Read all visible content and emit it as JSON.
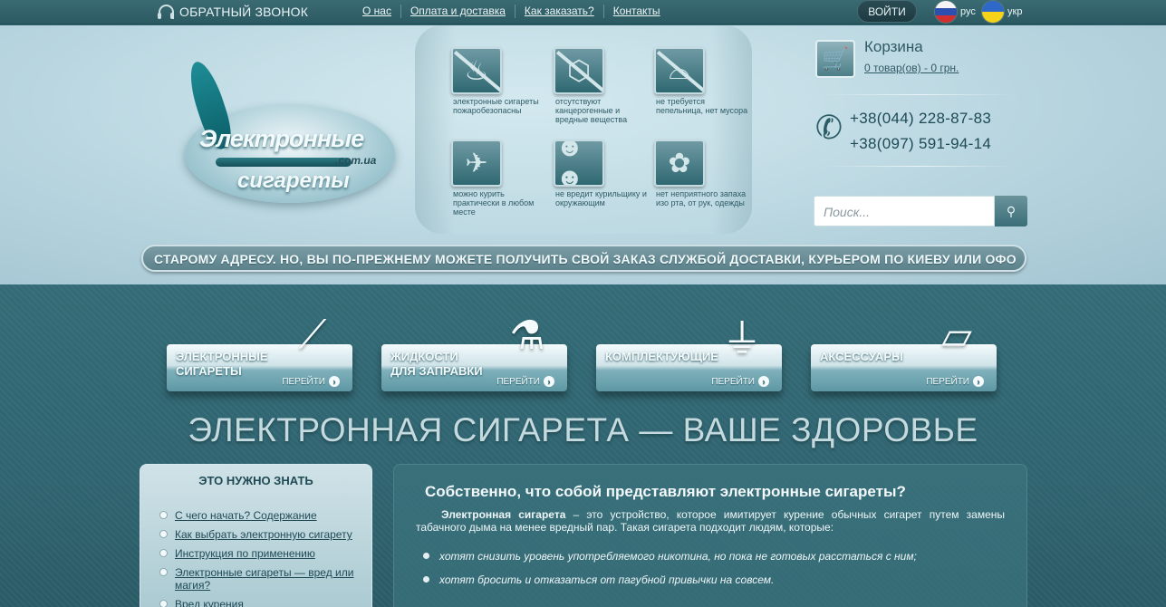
{
  "topbar": {
    "callback": "ОБРАТНЫЙ ЗВОНОК",
    "nav": [
      "О нас",
      "Оплата и доставка",
      "Как заказать?",
      "Контакты"
    ],
    "login": "ВОЙТИ",
    "lang_ru": "рус",
    "lang_ua": "укр"
  },
  "logo": {
    "line1": "Электронные",
    "domain": ".com.ua",
    "line2": "сигареты"
  },
  "features": [
    {
      "icon": "fire-icon",
      "text": "электронные сигареты пожаробезопасны"
    },
    {
      "icon": "molecule-icon",
      "text": "отсутствуют канцерогенные и вредные вещества"
    },
    {
      "icon": "ashtray-icon",
      "text": "не требуется пепельница, нет мусора"
    },
    {
      "icon": "airplane-icon",
      "text": "можно курить практически в любом месте"
    },
    {
      "icon": "people-icon",
      "text": "не вредит курильщику и окружающим"
    },
    {
      "icon": "flowers-icon",
      "text": "нет неприятного запаха изо рта, от рук, одежды"
    }
  ],
  "cart": {
    "title": "Корзина",
    "count": "0 товар(ов) - 0 грн."
  },
  "phones": [
    "+38(044) 228-87-83",
    "+38(097) 591-94-14"
  ],
  "search": {
    "placeholder": "Поиск..."
  },
  "ticker": "СТАРОМУ АДРЕСУ. НО, ВЫ ПО-ПРЕЖНЕМУ МОЖЕТЕ ПОЛУЧИТЬ СВОЙ ЗАКАЗ СЛУЖБОЙ ДОСТАВКИ, КУРЬЕРОМ ПО КИЕВУ ИЛИ ОФО",
  "categories": [
    {
      "name": "ЭЛЕКТРОННЫЕ\nСИГАРЕТЫ",
      "go": "ПЕРЕЙТИ",
      "icon": "cigarette-icon"
    },
    {
      "name": "ЖИДКОСТИ\nДЛЯ ЗАПРАВКИ",
      "go": "ПЕРЕЙТИ",
      "icon": "bottles-icon"
    },
    {
      "name": "КОМПЛЕКТУЮЩИЕ",
      "go": "ПЕРЕЙТИ",
      "icon": "charger-icon"
    },
    {
      "name": "АКСЕССУАРЫ",
      "go": "ПЕРЕЙТИ",
      "icon": "case-icon"
    }
  ],
  "slogan": "ЭЛЕКТРОННАЯ СИГАРЕТА — ВАШЕ ЗДОРОВЬЕ",
  "sidebar": {
    "title": "ЭТО НУЖНО ЗНАТЬ",
    "links": [
      "С чего начать? Содержание",
      "Как выбрать электронную сигарету",
      "Инструкция по применению",
      "Электронные сигареты — вред или магия?",
      "Вред курения"
    ]
  },
  "article": {
    "heading": "Собственно, что собой представляют электронные сигареты?",
    "lead_bold": "Электронная сигарета",
    "lead_rest": " – это устройство, которое имитирует курение обычных сигарет путем замены табачного дыма на менее вредный пар. Такая сигарета подходит людям, которые:",
    "bullets": [
      "хотят снизить уровень употребляемого никотина, но пока не готовых расстаться с ним;",
      "хотят бросить и отказаться от пагубной привычки на совсем."
    ]
  }
}
